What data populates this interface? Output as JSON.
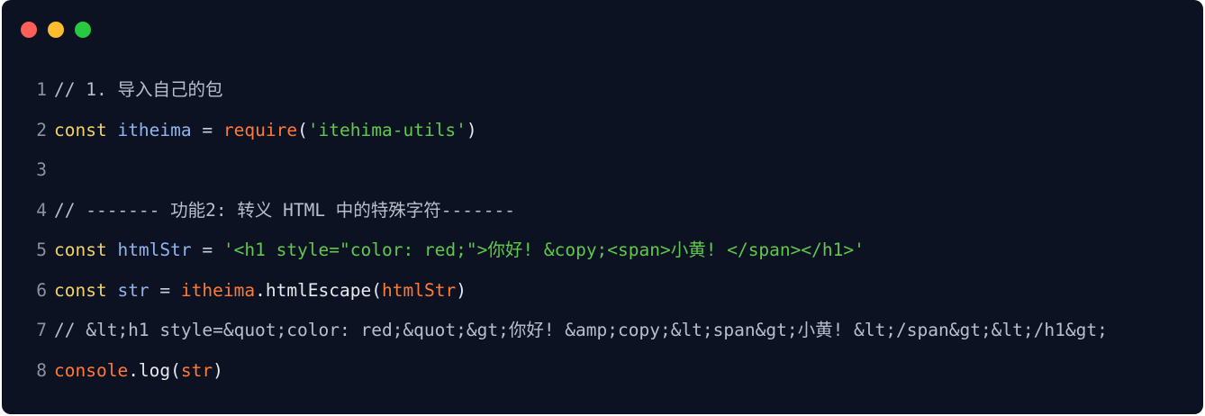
{
  "window": {
    "buttons": {
      "close_color": "#fe5f57",
      "minimize_color": "#febc2e",
      "maximize_color": "#28c840"
    }
  },
  "colors": {
    "background": "#0d1222",
    "comment": "#b8bfcc",
    "keyword": "#f2d36b",
    "variable": "#8fb4f0",
    "operator": "#c8cfdc",
    "function": "#ff7a36",
    "string": "#5ec94a",
    "punctuation": "#e6e9ef",
    "line_number": "#8b93a3"
  },
  "lines": [
    {
      "number": "1",
      "tokens": [
        {
          "text": "// 1. 导入自己的包",
          "type": "comment"
        }
      ]
    },
    {
      "number": "2",
      "tokens": [
        {
          "text": "const",
          "type": "keyword"
        },
        {
          "text": " ",
          "type": "operator"
        },
        {
          "text": "itheima",
          "type": "variable"
        },
        {
          "text": " = ",
          "type": "operator"
        },
        {
          "text": "require",
          "type": "function"
        },
        {
          "text": "(",
          "type": "punctuation"
        },
        {
          "text": "'itehima-utils'",
          "type": "string"
        },
        {
          "text": ")",
          "type": "punctuation"
        }
      ]
    },
    {
      "number": "3",
      "tokens": []
    },
    {
      "number": "4",
      "tokens": [
        {
          "text": "// ------- 功能2: 转义 HTML 中的特殊字符-------",
          "type": "comment"
        }
      ]
    },
    {
      "number": "5",
      "tokens": [
        {
          "text": "const",
          "type": "keyword"
        },
        {
          "text": " ",
          "type": "operator"
        },
        {
          "text": "htmlStr",
          "type": "variable"
        },
        {
          "text": " = ",
          "type": "operator"
        },
        {
          "text": "'<h1 style=\"color: red;\">你好! &copy;<span>小黄! </span></h1>'",
          "type": "string"
        }
      ]
    },
    {
      "number": "6",
      "tokens": [
        {
          "text": "const",
          "type": "keyword"
        },
        {
          "text": " ",
          "type": "operator"
        },
        {
          "text": "str",
          "type": "variable"
        },
        {
          "text": " = ",
          "type": "operator"
        },
        {
          "text": "itheima",
          "type": "function"
        },
        {
          "text": ".htmlEscape(",
          "type": "punctuation"
        },
        {
          "text": "htmlStr",
          "type": "function"
        },
        {
          "text": ")",
          "type": "punctuation"
        }
      ]
    },
    {
      "number": "7",
      "tokens": [
        {
          "text": "// &lt;h1 style=&quot;color: red;&quot;&gt;你好! &amp;copy;&lt;span&gt;小黄! &lt;/span&gt;&lt;/h1&gt;",
          "type": "comment"
        }
      ]
    },
    {
      "number": "8",
      "tokens": [
        {
          "text": "console",
          "type": "function"
        },
        {
          "text": ".log(",
          "type": "punctuation"
        },
        {
          "text": "str",
          "type": "function"
        },
        {
          "text": ")",
          "type": "punctuation"
        }
      ]
    }
  ]
}
